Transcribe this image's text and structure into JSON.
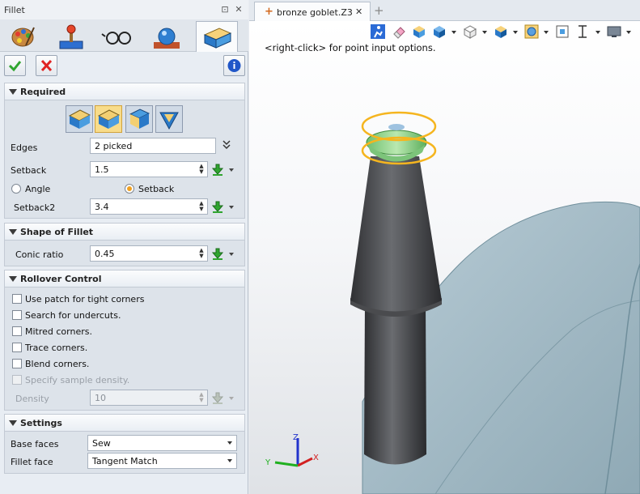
{
  "panel": {
    "title": "Fillet",
    "pin_symbol": "⊡",
    "close_symbol": "✕",
    "category_icons": [
      "paint-palette-icon",
      "joystick-icon",
      "eyeglasses-icon",
      "sphere-render-icon",
      "fillet-block-icon"
    ],
    "ok_icon": "checkmark-icon",
    "cancel_icon": "x-mark-icon",
    "info_icon": "info-icon"
  },
  "required": {
    "heading": "Required",
    "fillet_types": [
      "fillet-type-constant-icon",
      "fillet-type-variable-icon",
      "fillet-type-face-icon",
      "fillet-type-vertex-icon"
    ],
    "edges_label": "Edges",
    "edges_value": "2 picked",
    "setback_label": "Setback",
    "setback_value": "1.5",
    "angle_label": "Angle",
    "setback_radio_label": "Setback",
    "setback2_label": "Setback2",
    "setback2_value": "3.4"
  },
  "shape": {
    "heading": "Shape of Fillet",
    "conic_label": "Conic ratio",
    "conic_value": "0.45"
  },
  "rollover": {
    "heading": "Rollover Control",
    "options": [
      {
        "label": "Use patch for tight corners",
        "checked": false,
        "enabled": true
      },
      {
        "label": "Search for undercuts.",
        "checked": false,
        "enabled": true
      },
      {
        "label": "Mitred corners.",
        "checked": false,
        "enabled": true
      },
      {
        "label": "Trace corners.",
        "checked": false,
        "enabled": true
      },
      {
        "label": "Blend corners.",
        "checked": false,
        "enabled": true
      },
      {
        "label": "Specify sample density.",
        "checked": false,
        "enabled": false
      }
    ],
    "density_label": "Density",
    "density_value": "10"
  },
  "settings": {
    "heading": "Settings",
    "base_faces_label": "Base faces",
    "base_faces_value": "Sew",
    "fillet_face_label": "Fillet face",
    "fillet_face_value": "Tangent Match"
  },
  "document": {
    "tab_name": "bronze goblet.Z3",
    "tab_marker": "+",
    "close_symbol": "✕",
    "new_tab_symbol": "+",
    "hint": "<right-click> for point input options."
  },
  "view_toolbar_icons": [
    "run-icon",
    "eraser-icon",
    "box-filled-icon",
    "box-shaded-icon",
    "box-wire-icon",
    "box-view-icon",
    "gear-frame-icon",
    "fit-icon",
    "cursor-icon",
    "monitor-icon"
  ],
  "axes": {
    "x": "X",
    "y": "Y",
    "z": "Z"
  },
  "colors": {
    "accent": "#f0a020",
    "selection": "#f5b51f",
    "model": "#4d4f52",
    "surface": "#a9c0cb"
  }
}
